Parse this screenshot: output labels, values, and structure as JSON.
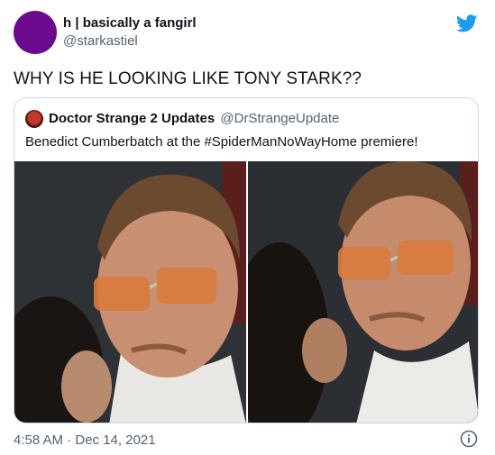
{
  "author": {
    "name": "h | basically a fangirl",
    "handle": "@starkastiel"
  },
  "tweet": {
    "text": "WHY IS HE LOOKING LIKE TONY STARK??",
    "timestamp": "4:58 AM · Dec 14, 2021"
  },
  "quoted_tweet": {
    "name": "Doctor Strange 2 Updates",
    "handle": "@DrStrangeUpdate",
    "text": "Benedict Cumberbatch at the #SpiderManNoWayHome premiere!"
  },
  "icons": [
    "twitter-bird-icon",
    "info-icon"
  ],
  "colors": {
    "brand": "#1d9bf0",
    "secondary_text": "#536471",
    "border": "#cfd9de"
  }
}
